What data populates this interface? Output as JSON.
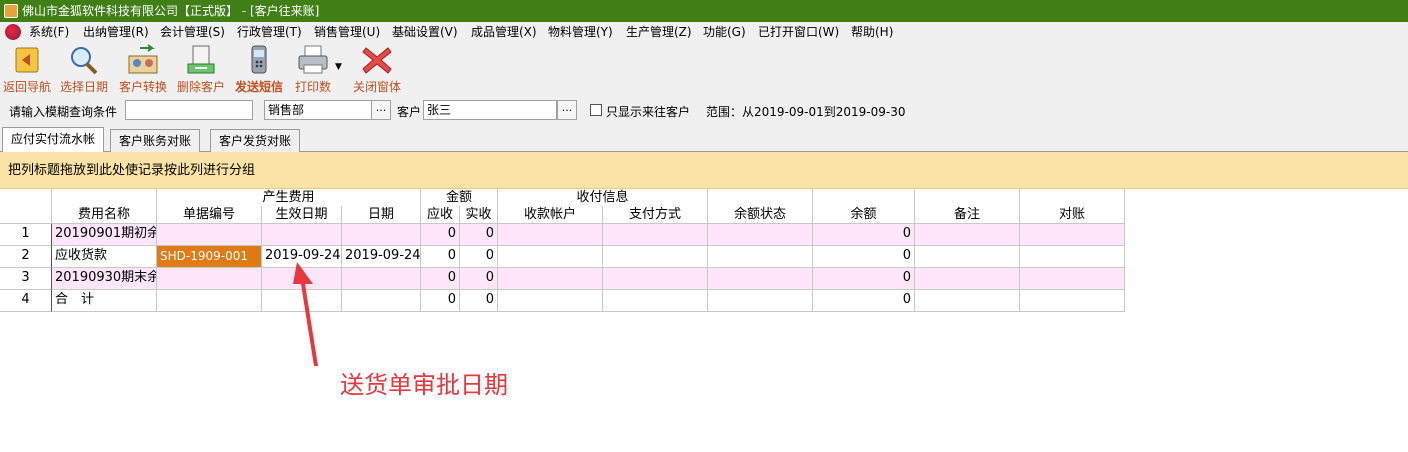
{
  "window": {
    "title": "佛山市金狐软件科技有限公司【正式版】 - [客户往来账]"
  },
  "menu": [
    "系统(F)",
    "出纳管理(R)",
    "会计管理(S)",
    "行政管理(T)",
    "销售管理(U)",
    "基础设置(V)",
    "成品管理(X)",
    "物料管理(Y)",
    "生产管理(Z)",
    "功能(G)",
    "已打开窗口(W)",
    "帮助(H)"
  ],
  "toolbar": {
    "back": "返回导航",
    "select_date": "选择日期",
    "convert_customer": "客户转换",
    "delete_customer": "删除客户",
    "send_sms": "发送短信",
    "print": "打印数",
    "close": "关闭窗体"
  },
  "filter": {
    "fuzzy_label": "请输入模糊查询条件",
    "fuzzy_value": "",
    "department": "销售部",
    "customer_label": "客户",
    "customer": "张三",
    "only_active_label": "只显示来往客户",
    "range": "范围：从2019-09-01到2019-09-30"
  },
  "tabs": [
    "应付实付流水帐",
    "客户账务对账",
    "客户发货对账"
  ],
  "group_hint": "把列标题拖放到此处使记录按此列进行分组",
  "grid": {
    "group_headers": {
      "fees": "产生费用",
      "amount": "金额",
      "payment": "收付信息"
    },
    "columns": [
      "费用名称",
      "单据编号",
      "生效日期",
      "日期",
      "应收",
      "实收",
      "收款帐户",
      "支付方式",
      "余额状态",
      "余额",
      "备注",
      "对账"
    ],
    "rows": [
      {
        "num": "1",
        "name": "20190901期初余",
        "doc": "",
        "eff": "",
        "date": "",
        "recv": "0",
        "paid": "0",
        "acct": "",
        "method": "",
        "status": "",
        "balance": "0",
        "note": "",
        "check": ""
      },
      {
        "num": "2",
        "name": "应收货款",
        "doc": "SHD-1909-001",
        "eff": "2019-09-24",
        "date": "2019-09-24",
        "recv": "0",
        "paid": "0",
        "acct": "",
        "method": "",
        "status": "",
        "balance": "0",
        "note": "",
        "check": ""
      },
      {
        "num": "3",
        "name": "20190930期末余",
        "doc": "",
        "eff": "",
        "date": "",
        "recv": "0",
        "paid": "0",
        "acct": "",
        "method": "",
        "status": "",
        "balance": "0",
        "note": "",
        "check": ""
      },
      {
        "num": "4",
        "name": "合　计",
        "doc": "",
        "eff": "",
        "date": "",
        "recv": "0",
        "paid": "0",
        "acct": "",
        "method": "",
        "status": "",
        "balance": "0",
        "note": "",
        "check": ""
      }
    ]
  },
  "annotation": {
    "text": "送货单审批日期",
    "color": "#e8383d"
  },
  "colors": {
    "titlebar": "#3f7f16",
    "group_bar": "#fbe3a6",
    "row_pink": "#fde6fa",
    "highlight": "#e07a14"
  }
}
